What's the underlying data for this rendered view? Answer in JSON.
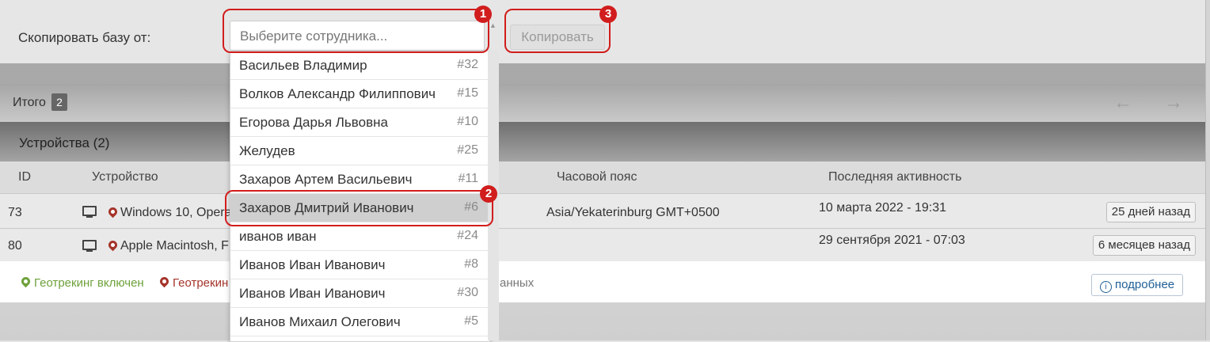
{
  "copy": {
    "label": "Скопировать базу от:",
    "select_placeholder": "Выберите сотрудника...",
    "copy_button": "Копировать"
  },
  "totals": {
    "label": "Итого",
    "count": "2"
  },
  "devices": {
    "title": "Устройства (2)",
    "columns": {
      "id": "ID",
      "device": "Устройство",
      "timezone": "Часовой пояс",
      "last_activity": "Последняя активность"
    },
    "rows": [
      {
        "id": "73",
        "device": "Windows 10, Opera",
        "timezone": "Asia/Yekaterinburg GMT+0500",
        "activity": "10 марта 2022 - 19:31",
        "ago": "25 дней назад"
      },
      {
        "id": "80",
        "device": "Apple Macintosh, Fi",
        "timezone": "",
        "activity": "29 сентября 2021 - 07:03",
        "ago": "6 месяцев назад"
      }
    ]
  },
  "legend": {
    "geotracking_on": "Геотрекинг включен",
    "geotracking_off_partial": "Геотрекин",
    "tail_partial": "анных",
    "details_button": "подробнее"
  },
  "employees": [
    {
      "name": "Васильев Владимир",
      "id": "#32"
    },
    {
      "name": "Волков Александр Филиппович",
      "id": "#15"
    },
    {
      "name": "Егорова Дарья Львовна",
      "id": "#10"
    },
    {
      "name": "Желудев",
      "id": "#25"
    },
    {
      "name": "Захаров Артем Васильевич",
      "id": "#11"
    },
    {
      "name": "Захаров Дмитрий Иванович",
      "id": "#6"
    },
    {
      "name": "иванов иван",
      "id": "#24"
    },
    {
      "name": "Иванов Иван Иванович",
      "id": "#8"
    },
    {
      "name": "Иванов Иван Иванович",
      "id": "#30"
    },
    {
      "name": "Иванов Михаил Олегович",
      "id": "#5"
    }
  ],
  "annotations": [
    "1",
    "2",
    "3"
  ],
  "colors": {
    "annotation": "#d11d1d",
    "geo_on": "#6ea13b",
    "geo_off": "#a5342a",
    "selected_option": "#cfcfcf"
  }
}
